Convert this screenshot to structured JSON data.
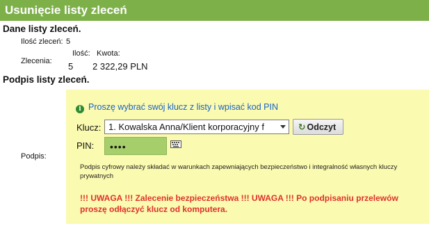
{
  "header": {
    "title": "Usunięcie listy zleceń"
  },
  "details": {
    "section_title": "Dane listy zleceń.",
    "count_label": "Ilość zleceń:",
    "count_value": "5",
    "orders_label": "Zlecenia:",
    "qty_header": "Ilość:",
    "amount_header": "Kwota:",
    "qty_value": "5",
    "amount_value": "2 322,29 PLN"
  },
  "signature": {
    "section_title": "Podpis listy zleceń.",
    "field_label": "Podpis:",
    "info_icon": "info-icon",
    "info_text": "Proszę wybrać swój klucz z listy i wpisać kod PIN",
    "key_label": "Klucz:",
    "key_selected": "1. Kowalska Anna/Klient korporacyjny f",
    "read_button": "Odczyt",
    "pin_label": "PIN:",
    "pin_value": "••••",
    "note": "Podpis cyfrowy należy składać w warunkach zapewniających bezpieczeństwo i integralność własnych kluczy prywatnych",
    "warning": "!!! UWAGA !!! Zalecenie bezpieczeństwa !!! UWAGA !!! Po podpisaniu przelewów proszę odłączyć klucz od komputera."
  },
  "colors": {
    "header_bg": "#7eb04a",
    "panel_bg": "#fafab0",
    "pin_bg": "#a6cf6b",
    "info_text": "#1a62c7",
    "warning_text": "#e0302b"
  }
}
